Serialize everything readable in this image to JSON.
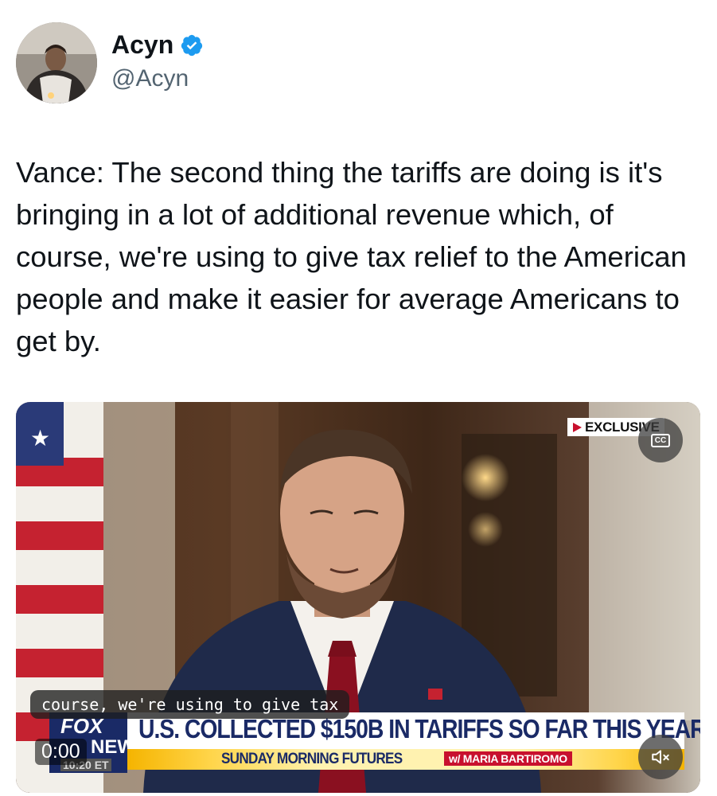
{
  "author": {
    "name": "Acyn",
    "handle": "@Acyn",
    "verified_color": "#1d9bf0"
  },
  "tweet": {
    "text": "Vance: The second thing the tariffs are doing is it's bringing in a lot of additional revenue which, of course, we're using to give tax relief to the American people and make it easier for average Americans to get by."
  },
  "video": {
    "badge": "EXCLUSIVE",
    "cc_label": "CC",
    "caption": "course, we're using to give tax",
    "network_logo_top": "FOX",
    "network_logo_bottom": "NEWS",
    "clock": "10:20 ET",
    "headline": "U.S. COLLECTED $150B IN TARIFFS SO FAR THIS YEAR",
    "show_title": "SUNDAY MORNING FUTURES",
    "show_host": "w/ MARIA BARTIROMO",
    "timestamp": "0:00",
    "mute_icon": "speaker-muted-icon"
  }
}
